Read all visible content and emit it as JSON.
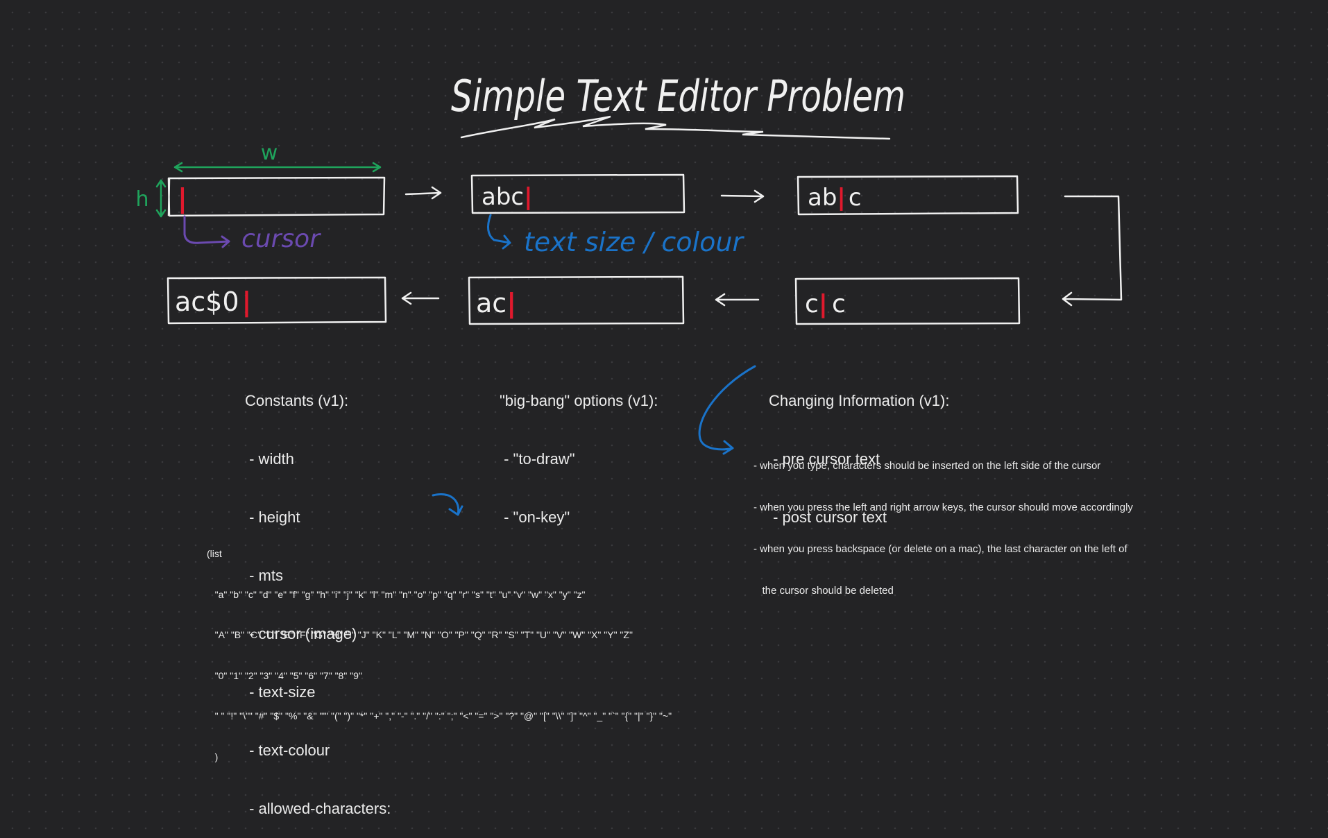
{
  "title": "Simple Text Editor Problem",
  "annotations": {
    "width_label": "w",
    "height_label": "h",
    "cursor_label": "cursor",
    "text_label": "text size / colour"
  },
  "editor_states": {
    "s1": {
      "text": "",
      "cursor": "|"
    },
    "s2": {
      "text": "abc",
      "cursor": "|"
    },
    "s3": {
      "pre": "ab",
      "cursor": "|",
      "post": "c"
    },
    "s4": {
      "pre": "c",
      "cursor": "|",
      "post": "c"
    },
    "s5": {
      "text": "ac",
      "cursor": "|"
    },
    "s6": {
      "text": "ac$0",
      "cursor": "|"
    }
  },
  "constants": {
    "heading": "Constants (v1):",
    "items": [
      " - width",
      " - height",
      " - mts",
      " - cursor (image)",
      " - text-size",
      " - text-colour",
      " - allowed-characters:"
    ]
  },
  "big_bang": {
    "heading": "\"big-bang\" options (v1):",
    "items": [
      " - \"to-draw\"",
      " - \"on-key\""
    ]
  },
  "changing": {
    "heading": "Changing Information (v1):",
    "items": [
      " - pre cursor text",
      " - post cursor text"
    ]
  },
  "notes": [
    "- when you type, characters should be inserted on the left side of the cursor",
    "- when you press the left and right arrow keys, the cursor should move accordingly",
    "- when you press backspace (or delete on a mac), the last character on the left of",
    "   the cursor should be deleted"
  ],
  "char_list": [
    "(list",
    "   \"a\" \"b\" \"c\" \"d\" \"e\" \"f\" \"g\" \"h\" \"i\" \"j\" \"k\" \"l\" \"m\" \"n\" \"o\" \"p\" \"q\" \"r\" \"s\" \"t\" \"u\" \"v\" \"w\" \"x\" \"y\" \"z\"",
    "   \"A\" \"B\" \"C\" \"D\" \"E\" \"F\" \"G\" \"H\" \"I\" \"J\" \"K\" \"L\" \"M\" \"N\" \"O\" \"P\" \"Q\" \"R\" \"S\" \"T\" \"U\" \"V\" \"W\" \"X\" \"Y\" \"Z\"",
    "   \"0\" \"1\" \"2\" \"3\" \"4\" \"5\" \"6\" \"7\" \"8\" \"9\"",
    "   \" \" \"!\" \"\\\"\" \"#\" \"$\" \"%\" \"&\" \"'\" \"(\" \")\" \"*\" \"+\" \",\" \"-\" \".\" \"/\" \":\" \";\" \"<\" \"=\" \">\" \"?\" \"@\" \"[\" \"\\\\\" \"]\" \"^\" \"_\" \"`\" \"{\" \"|\" \"}\" \"~\"",
    "   )"
  ],
  "colors": {
    "background": "#232325",
    "ink": "#e8e8e8",
    "cursor": "#e0192d",
    "green": "#1fa45c",
    "purple": "#6b4ab0",
    "blue": "#1a73c9"
  }
}
